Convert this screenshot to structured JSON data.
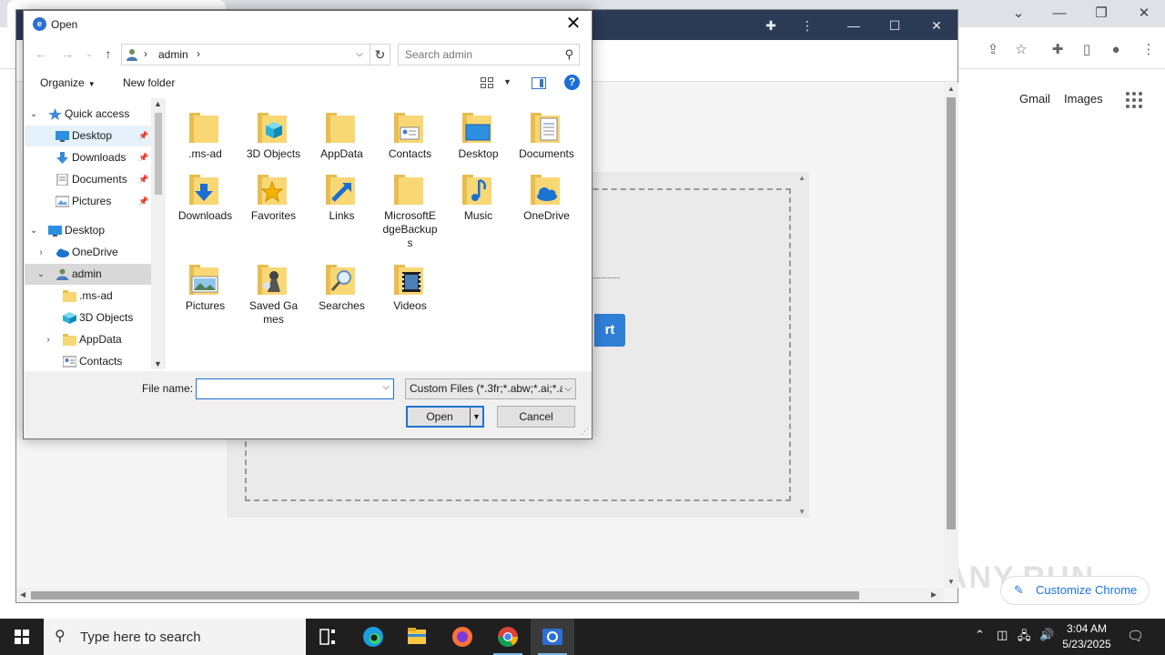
{
  "dialog": {
    "title": "Open",
    "path_crumb": "admin",
    "search_placeholder": "Search admin",
    "organize_label": "Organize",
    "new_folder_label": "New folder",
    "help_glyph": "?",
    "nav_tree": [
      {
        "label": "Quick access",
        "icon": "star-icon"
      },
      {
        "label": "Desktop",
        "icon": "desktop-icon",
        "pinned": true
      },
      {
        "label": "Downloads",
        "icon": "download-arrow-icon",
        "pinned": true
      },
      {
        "label": "Documents",
        "icon": "documents-icon",
        "pinned": true
      },
      {
        "label": "Pictures",
        "icon": "pictures-icon",
        "pinned": true
      },
      {
        "label": "Desktop",
        "icon": "desktop-icon"
      },
      {
        "label": "OneDrive",
        "icon": "cloud-icon"
      },
      {
        "label": "admin",
        "icon": "user-icon"
      },
      {
        "label": ".ms-ad",
        "icon": "folder-icon"
      },
      {
        "label": "3D Objects",
        "icon": "cube-icon"
      },
      {
        "label": "AppData",
        "icon": "folder-icon"
      },
      {
        "label": "Contacts",
        "icon": "contacts-icon"
      }
    ],
    "files": [
      {
        "name": ".ms-ad",
        "icon": "folder-icon"
      },
      {
        "name": "3D Objects",
        "icon": "cube-folder-icon"
      },
      {
        "name": "AppData",
        "icon": "folder-icon"
      },
      {
        "name": "Contacts",
        "icon": "contacts-folder-icon"
      },
      {
        "name": "Desktop",
        "icon": "desktop-folder-icon"
      },
      {
        "name": "Documents",
        "icon": "documents-folder-icon"
      },
      {
        "name": "Downloads",
        "icon": "downloads-folder-icon"
      },
      {
        "name": "Favorites",
        "icon": "favorites-folder-icon"
      },
      {
        "name": "Links",
        "icon": "links-folder-icon"
      },
      {
        "name": "MicrosoftEdgeBackups",
        "icon": "folder-icon"
      },
      {
        "name": "Music",
        "icon": "music-folder-icon"
      },
      {
        "name": "OneDrive",
        "icon": "onedrive-folder-icon"
      },
      {
        "name": "Pictures",
        "icon": "pictures-folder-icon"
      },
      {
        "name": "Saved Games",
        "icon": "saved-games-folder-icon"
      },
      {
        "name": "Searches",
        "icon": "searches-folder-icon"
      },
      {
        "name": "Videos",
        "icon": "videos-folder-icon"
      }
    ],
    "file_name_label": "File name:",
    "file_name_value": "",
    "file_type_selected": "Custom Files (*.3fr;*.abw;*.ai;*.a",
    "open_label": "Open",
    "cancel_label": "Cancel"
  },
  "page": {
    "start_button_text": "rt"
  },
  "chrome": {
    "gmail_label": "Gmail",
    "images_label": "Images",
    "customize_label": "Customize Chrome",
    "watermark": "ANY.RUN"
  },
  "taskbar": {
    "search_placeholder": "Type here to search",
    "time": "3:04 AM",
    "date": "5/23/2025"
  },
  "colors": {
    "accent": "#1e72d3",
    "folder": "#f8d775",
    "page_titlebar": "#2b3a55",
    "taskbar": "#1f1f1f"
  }
}
